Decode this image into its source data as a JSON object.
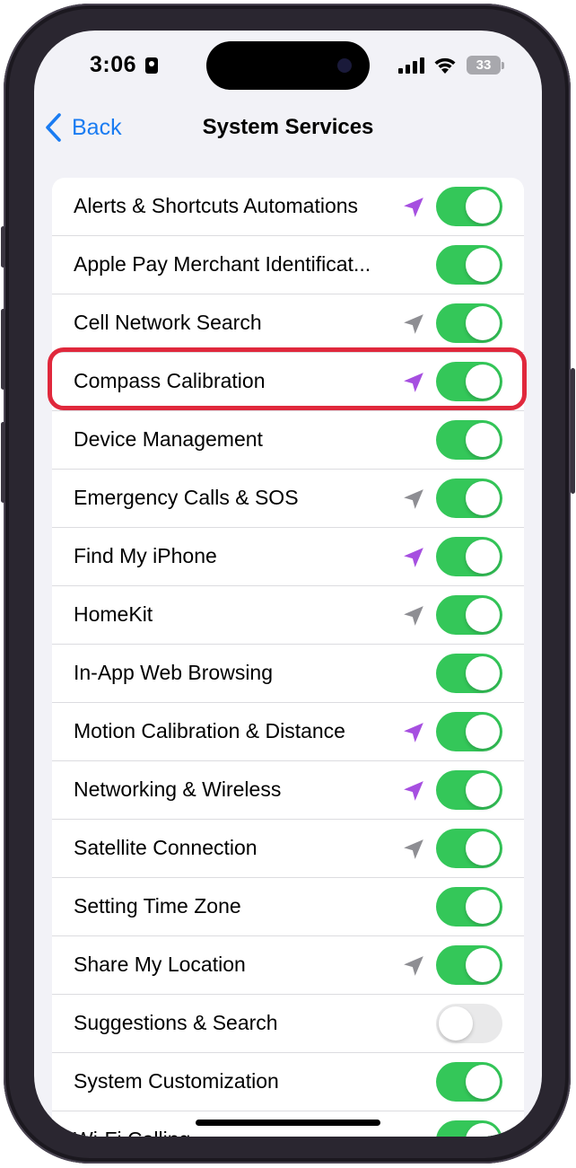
{
  "status_bar": {
    "time": "3:06",
    "battery": "33"
  },
  "nav": {
    "back_label": "Back",
    "title": "System Services"
  },
  "colors": {
    "toggle_on": "#34c759",
    "toggle_off": "#e9e9ea",
    "arrow_purple": "#a64fe0",
    "arrow_gray": "#8e8e93",
    "highlight": "#e0283c",
    "link_blue": "#1a7cf2"
  },
  "services": [
    {
      "label": "Alerts & Shortcuts Automations",
      "arrow": "purple",
      "on": true
    },
    {
      "label": "Apple Pay Merchant Identificat...",
      "arrow": "none",
      "on": true
    },
    {
      "label": "Cell Network Search",
      "arrow": "gray",
      "on": true
    },
    {
      "label": "Compass Calibration",
      "arrow": "purple",
      "on": true,
      "highlighted": true
    },
    {
      "label": "Device Management",
      "arrow": "none",
      "on": true
    },
    {
      "label": "Emergency Calls & SOS",
      "arrow": "gray",
      "on": true
    },
    {
      "label": "Find My iPhone",
      "arrow": "purple",
      "on": true
    },
    {
      "label": "HomeKit",
      "arrow": "gray",
      "on": true
    },
    {
      "label": "In-App Web Browsing",
      "arrow": "none",
      "on": true
    },
    {
      "label": "Motion Calibration & Distance",
      "arrow": "purple",
      "on": true
    },
    {
      "label": "Networking & Wireless",
      "arrow": "purple",
      "on": true
    },
    {
      "label": "Satellite Connection",
      "arrow": "gray",
      "on": true
    },
    {
      "label": "Setting Time Zone",
      "arrow": "none",
      "on": true
    },
    {
      "label": "Share My Location",
      "arrow": "gray",
      "on": true
    },
    {
      "label": "Suggestions & Search",
      "arrow": "none",
      "on": false
    },
    {
      "label": "System Customization",
      "arrow": "none",
      "on": true
    },
    {
      "label": "Wi-Fi Calling",
      "arrow": "none",
      "on": true
    }
  ]
}
